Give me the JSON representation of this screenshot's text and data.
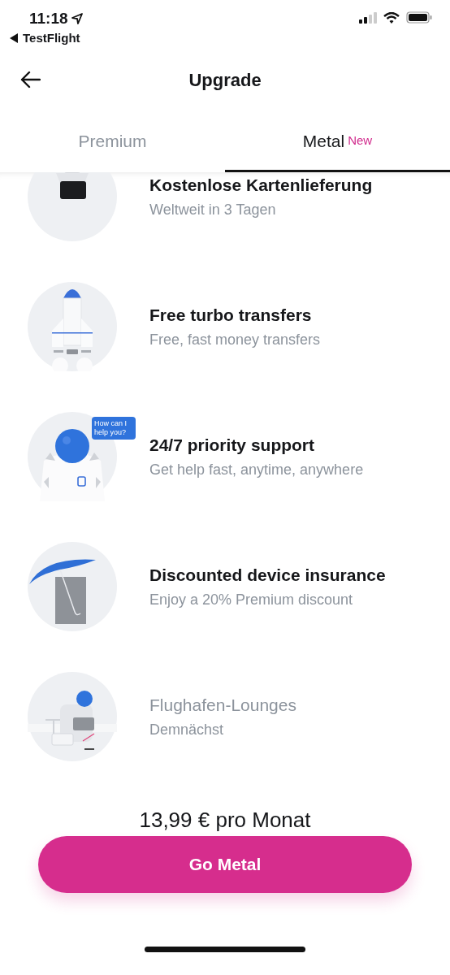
{
  "status_bar": {
    "time": "11:18",
    "back_app": "TestFlight"
  },
  "nav": {
    "title": "Upgrade"
  },
  "tabs": [
    {
      "label": "Premium",
      "selected": false
    },
    {
      "label": "Metal",
      "selected": true,
      "badge": "New"
    }
  ],
  "features": [
    {
      "kind": "drone",
      "title": "Kostenlose Kartenlieferung",
      "subtitle": "Weltweit in 3 Tagen",
      "disabled": false
    },
    {
      "kind": "rocket",
      "title": "Free turbo transfers",
      "subtitle": "Free, fast money transfers",
      "disabled": false
    },
    {
      "kind": "astronaut",
      "title": "24/7 priority support",
      "subtitle": "Get help fast, anytime, anywhere",
      "disabled": false,
      "bubble": "How can I help you?"
    },
    {
      "kind": "umbrella",
      "title": "Discounted device insurance",
      "subtitle": "Enjoy a 20% Premium discount",
      "disabled": false
    },
    {
      "kind": "lounge",
      "title": "Flughafen-Lounges",
      "subtitle": "Demnächst",
      "disabled": true
    }
  ],
  "price": "13,99 € pro Monat",
  "cta": "Go Metal"
}
